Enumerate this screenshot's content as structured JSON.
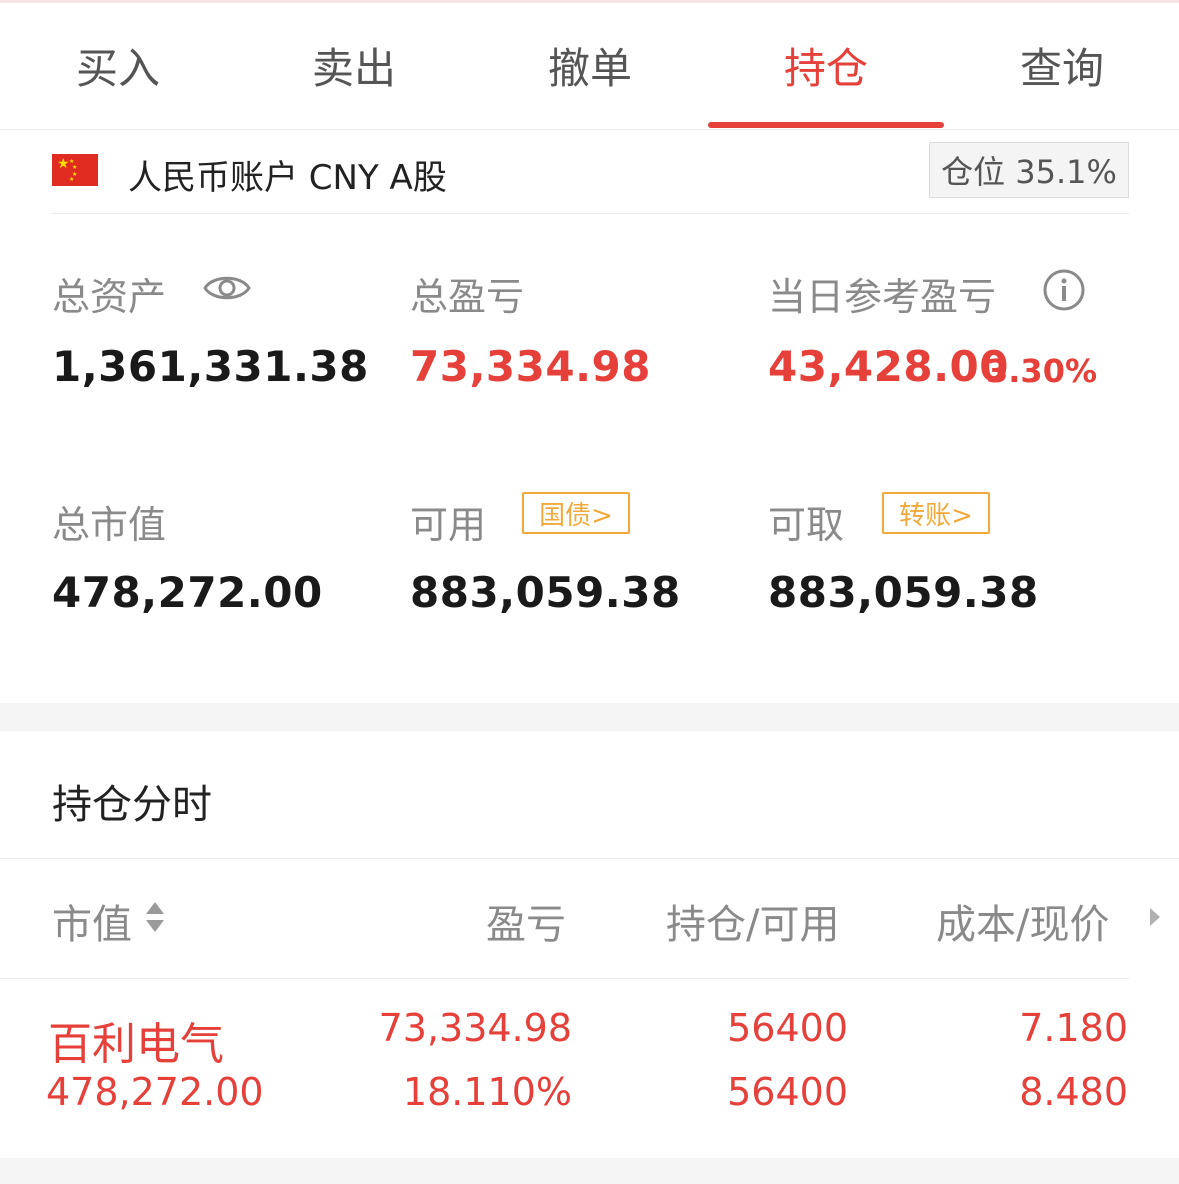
{
  "tabs": [
    {
      "label": "买入"
    },
    {
      "label": "卖出"
    },
    {
      "label": "撤单"
    },
    {
      "label": "持仓"
    },
    {
      "label": "查询"
    }
  ],
  "active_tab": "持仓",
  "account": {
    "label": "人民币账户 CNY A股",
    "position_ratio": "仓位 35.1%"
  },
  "summary": {
    "total_assets": {
      "label": "总资产",
      "value": "1,361,331.38"
    },
    "total_pnl": {
      "label": "总盈亏",
      "value": "73,334.98"
    },
    "daily_pnl": {
      "label": "当日参考盈亏",
      "value": "43,428.00",
      "percent": "3.30%"
    },
    "market_value": {
      "label": "总市值",
      "value": "478,272.00"
    },
    "available": {
      "label": "可用",
      "value": "883,059.38",
      "tag": "国债>"
    },
    "withdrawable": {
      "label": "可取",
      "value": "883,059.38",
      "tag": "转账>"
    }
  },
  "holdings": {
    "title": "持仓分时",
    "headers": {
      "market_value": "市值",
      "pnl": "盈亏",
      "position": "持仓/可用",
      "cost_price": "成本/现价"
    },
    "rows": [
      {
        "name": "百利电气",
        "market_value": "478,272.00",
        "pnl": "73,334.98",
        "pnl_pct": "18.110%",
        "position": "56400",
        "available": "56400",
        "cost": "7.180",
        "price": "8.480"
      }
    ]
  },
  "colors": {
    "accent": "#e5403a",
    "tag": "#f0a93a",
    "label": "#8a8a8a"
  },
  "icons": [
    "eye-icon",
    "info-icon",
    "sort-icon",
    "chevron-right-icon",
    "china-flag-icon"
  ]
}
